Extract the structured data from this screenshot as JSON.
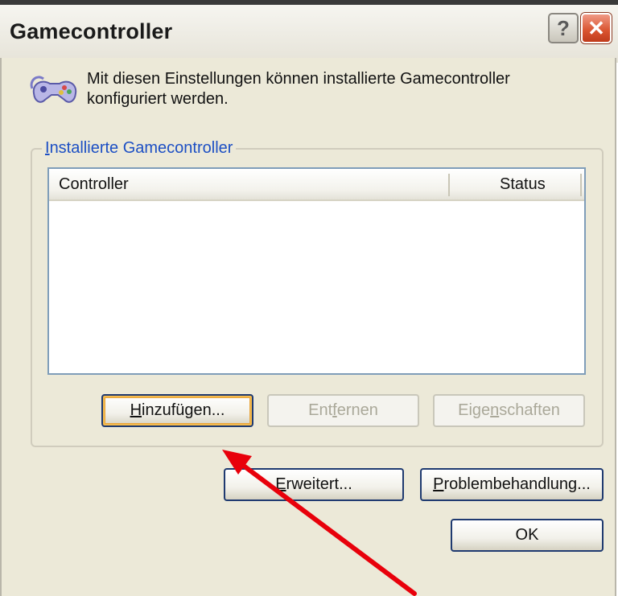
{
  "window": {
    "title": "Gamecontroller",
    "help_glyph": "?",
    "close_glyph": "✕"
  },
  "intro": {
    "text": "Mit diesen Einstellungen können installierte Gamecontroller konfiguriert werden.",
    "icon": "gamepad-icon"
  },
  "group": {
    "label_accel": "I",
    "label_rest": "nstallierte Gamecontroller"
  },
  "list": {
    "columns": [
      "Controller",
      "Status"
    ],
    "rows": []
  },
  "buttons": {
    "add": {
      "accel": "H",
      "rest": "inzufügen..."
    },
    "remove": {
      "pre": "Ent",
      "accel": "f",
      "post": "ernen"
    },
    "properties": {
      "pre": "Eige",
      "accel": "n",
      "post": "schaften"
    },
    "advanced": {
      "accel": "E",
      "rest": "rweitert..."
    },
    "troubleshoot": {
      "accel": "P",
      "rest": "roblembehandlung..."
    },
    "ok": "OK"
  },
  "colors": {
    "annotation_arrow": "#e8000b",
    "dialog_face": "#ece9d8",
    "group_label": "#1c4fc4"
  }
}
